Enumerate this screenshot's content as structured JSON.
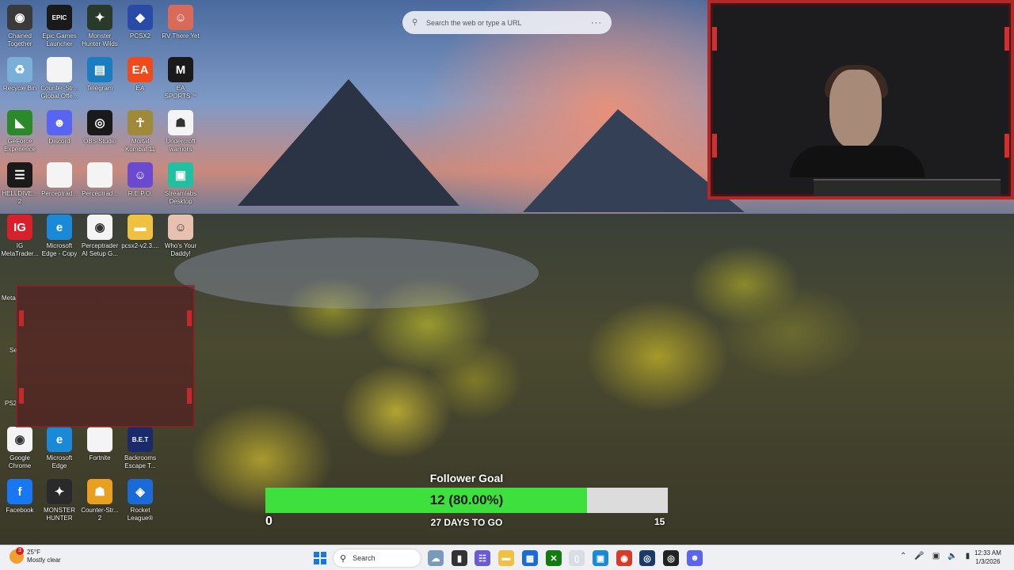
{
  "desktop_icons": [
    {
      "label": "Chained Together",
      "icon": "game-icon",
      "color": "#3a3a3a",
      "glyph": "◉"
    },
    {
      "label": "Epic Games Launcher",
      "icon": "epic-games-icon",
      "color": "#1a1a1a",
      "glyph": "EPIC"
    },
    {
      "label": "Monster Hunter Wilds",
      "icon": "game-icon",
      "color": "#2a3a2a",
      "glyph": "✦"
    },
    {
      "label": "PCSX2",
      "icon": "pcsx2-icon",
      "color": "#2a4aa8",
      "glyph": "◆"
    },
    {
      "label": "RV There Yet",
      "icon": "game-icon",
      "color": "#d86a5a",
      "glyph": "☺"
    },
    {
      "label": "Recycle Bin",
      "icon": "recycle-bin-icon",
      "color": "#7ab0d8",
      "glyph": "♻"
    },
    {
      "label": "Counter-Str... Global Offe...",
      "icon": "file-icon",
      "color": "#f4f4f4",
      "glyph": ""
    },
    {
      "label": "Telegram",
      "icon": "telegram-icon",
      "color": "#1c7cc0",
      "glyph": "▤"
    },
    {
      "label": "EA",
      "icon": "ea-icon",
      "color": "#f04a1a",
      "glyph": "EA"
    },
    {
      "label": "EA SPORTS™ Madden N...",
      "icon": "game-icon",
      "color": "#1a1a1a",
      "glyph": "M"
    },
    {
      "label": "GeForce Experience",
      "icon": "nvidia-icon",
      "color": "#2a8a2a",
      "glyph": "◣"
    },
    {
      "label": "Discord",
      "icon": "discord-icon",
      "color": "#5865f2",
      "glyph": "☻"
    },
    {
      "label": "OBS Studio",
      "icon": "obs-icon",
      "color": "#1a1a1a",
      "glyph": "◎"
    },
    {
      "label": "Mortal Kombat 11",
      "icon": "game-icon",
      "color": "#a08a3a",
      "glyph": "☥"
    },
    {
      "label": "Undercroft warriors",
      "icon": "game-icon",
      "color": "#f4f4f4",
      "glyph": "☗"
    },
    {
      "label": "HELLDIVE... 2",
      "icon": "game-icon",
      "color": "#1a1a1a",
      "glyph": "☰"
    },
    {
      "label": "Perceptrad...",
      "icon": "file-icon",
      "color": "#f4f4f4",
      "glyph": ""
    },
    {
      "label": "Perceptrad...",
      "icon": "file-icon",
      "color": "#f4f4f4",
      "glyph": ""
    },
    {
      "label": "R.E.P.O.",
      "icon": "game-icon",
      "color": "#6a4ad0",
      "glyph": "☺"
    },
    {
      "label": "Streamlabs Desktop",
      "icon": "streamlabs-icon",
      "color": "#20c0a0",
      "glyph": "▣"
    },
    {
      "label": "IG MetaTrader...",
      "icon": "ig-icon",
      "color": "#d8202a",
      "glyph": "IG"
    },
    {
      "label": "Microsoft Edge - Copy",
      "icon": "edge-icon",
      "color": "#1a8ad8",
      "glyph": "e"
    },
    {
      "label": "Perceptrader AI Setup G...",
      "icon": "chrome-icon",
      "color": "#f4f4f4",
      "glyph": "◉"
    },
    {
      "label": "pcsx2-v2.3....",
      "icon": "folder-icon",
      "color": "#f0c040",
      "glyph": "▬"
    },
    {
      "label": "Who's Your Daddy!",
      "icon": "game-icon",
      "color": "#e8c0b0",
      "glyph": "☺"
    },
    {
      "label": "Google Chrome",
      "icon": "chrome-icon",
      "color": "#f4f4f4",
      "glyph": "◉"
    },
    {
      "label": "Microsoft Edge",
      "icon": "edge-icon",
      "color": "#1a8ad8",
      "glyph": "e"
    },
    {
      "label": "Fortnite",
      "icon": "file-icon",
      "color": "#f4f4f4",
      "glyph": ""
    },
    {
      "label": "Backrooms Escape T...",
      "icon": "game-icon",
      "color": "#1a2a6a",
      "glyph": "B.E.T"
    },
    {
      "label": "Facebook",
      "icon": "facebook-icon",
      "color": "#1877f2",
      "glyph": "f"
    },
    {
      "label": "MONSTER HUNTER RI...",
      "icon": "game-icon",
      "color": "#2a2a2a",
      "glyph": "✦"
    },
    {
      "label": "Counter-Str... 2",
      "icon": "cs2-icon",
      "color": "#e8a020",
      "glyph": "☗"
    },
    {
      "label": "Rocket League®",
      "icon": "rocket-league-icon",
      "color": "#1a6ad8",
      "glyph": "◈"
    }
  ],
  "partial_labels": {
    "meta": "Meta",
    "se": "Se",
    "ps2": "PS2"
  },
  "search_bar": {
    "placeholder": "Search the web or type a URL",
    "more": "···"
  },
  "follower_goal": {
    "title": "Follower Goal",
    "current": 12,
    "target": 15,
    "progress": 0.8,
    "progress_text": "12 (80.00%)",
    "min_label": "0",
    "max_label": "15",
    "days_left": "27 DAYS TO GO",
    "fill_color": "#3ee03e",
    "track_color": "#dcdcdc"
  },
  "taskbar": {
    "weather_temp": "25°F",
    "weather_desc": "Mostly clear",
    "weather_badge": "3",
    "search_label": "Search",
    "apps": [
      {
        "name": "widgets-icon",
        "glyph": "☁",
        "color": "#7a9aba"
      },
      {
        "name": "task-view-icon",
        "glyph": "▮",
        "color": "#333333"
      },
      {
        "name": "teams-icon",
        "glyph": "☷",
        "color": "#6a5ad8"
      },
      {
        "name": "file-explorer-icon",
        "glyph": "▬",
        "color": "#f0c040"
      },
      {
        "name": "store-icon",
        "glyph": "▦",
        "color": "#1a6ad8"
      },
      {
        "name": "xbox-icon",
        "glyph": "✕",
        "color": "#107c10"
      },
      {
        "name": "notepad-icon",
        "glyph": "▯",
        "color": "#d8dce4"
      },
      {
        "name": "remote-desktop-icon",
        "glyph": "▣",
        "color": "#1a8ad8"
      },
      {
        "name": "chrome-icon",
        "glyph": "◉",
        "color": "#d83a2a"
      },
      {
        "name": "steam-icon",
        "glyph": "◎",
        "color": "#1a3a6a"
      },
      {
        "name": "obs-icon",
        "glyph": "◎",
        "color": "#222222"
      },
      {
        "name": "discord-icon",
        "glyph": "☻",
        "color": "#5865f2"
      }
    ],
    "time": "12:33 AM",
    "date": "1/3/2026"
  }
}
